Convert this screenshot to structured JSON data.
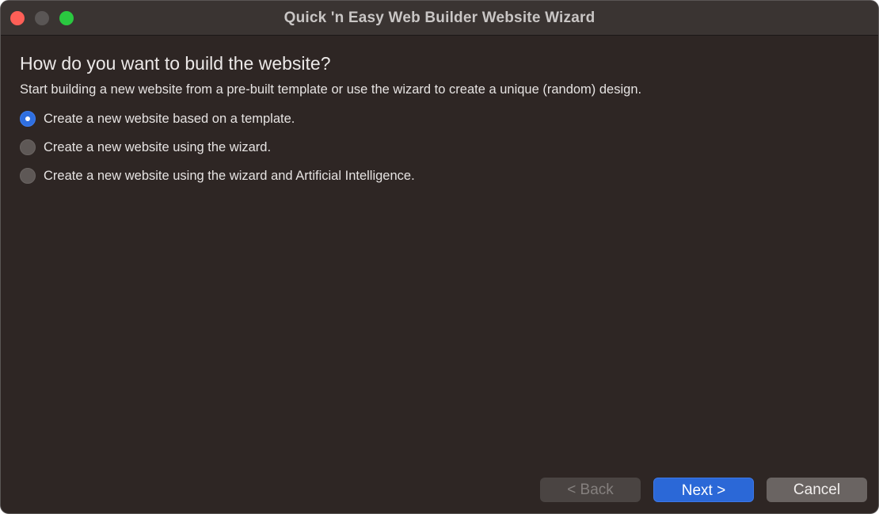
{
  "window": {
    "title": "Quick 'n Easy Web Builder Website Wizard"
  },
  "page": {
    "heading": "How do you want to build the website?",
    "subtitle": "Start building a new website from a pre-built template or use the wizard to create a unique (random) design."
  },
  "options": [
    {
      "label": "Create a new website based on a template.",
      "selected": true
    },
    {
      "label": "Create a new website using the wizard.",
      "selected": false
    },
    {
      "label": "Create a new website using the wizard and Artificial Intelligence.",
      "selected": false
    }
  ],
  "buttons": {
    "back_label": "< Back",
    "next_label": "Next >",
    "cancel_label": "Cancel"
  },
  "colors": {
    "accent": "#2b68d7",
    "window_background": "#2e2624",
    "titlebar": "#3a3432",
    "close": "#fe5f57",
    "zoom": "#2ac840"
  },
  "icons": {
    "close": "close-window-icon",
    "minimize": "minimize-window-icon",
    "zoom": "zoom-window-icon"
  }
}
